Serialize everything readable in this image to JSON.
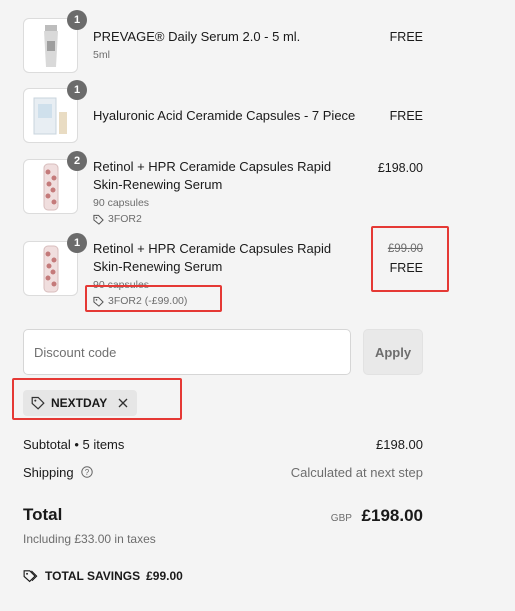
{
  "items": [
    {
      "qty": "1",
      "name": "PREVAGE® Daily Serum 2.0 - 5 ml.",
      "variant": "5ml",
      "price": "FREE"
    },
    {
      "qty": "1",
      "name": "Hyaluronic Acid Ceramide Capsules - 7 Piece",
      "price": "FREE"
    },
    {
      "qty": "2",
      "name": "Retinol + HPR Ceramide Capsules Rapid Skin-Renewing Serum",
      "variant": "90 capsules",
      "discount": "3FOR2",
      "price": "£198.00"
    },
    {
      "qty": "1",
      "name": "Retinol + HPR Ceramide Capsules Rapid Skin-Renewing Serum",
      "variant": "90 capsules",
      "discount": "3FOR2 (-£99.00)",
      "original_price": "£99.00",
      "price": "FREE"
    }
  ],
  "discount": {
    "placeholder": "Discount code",
    "apply_label": "Apply",
    "applied_code": "NEXTDAY"
  },
  "summary": {
    "subtotal_label": "Subtotal • 5 items",
    "subtotal_value": "£198.00",
    "shipping_label": "Shipping",
    "shipping_value": "Calculated at next step",
    "total_label": "Total",
    "currency": "GBP",
    "total_value": "£198.00",
    "taxes_note": "Including £33.00 in taxes",
    "savings_label": "TOTAL SAVINGS",
    "savings_value": "£99.00"
  },
  "colors": {
    "highlight": "#e53935",
    "background": "#f4f4f4"
  }
}
